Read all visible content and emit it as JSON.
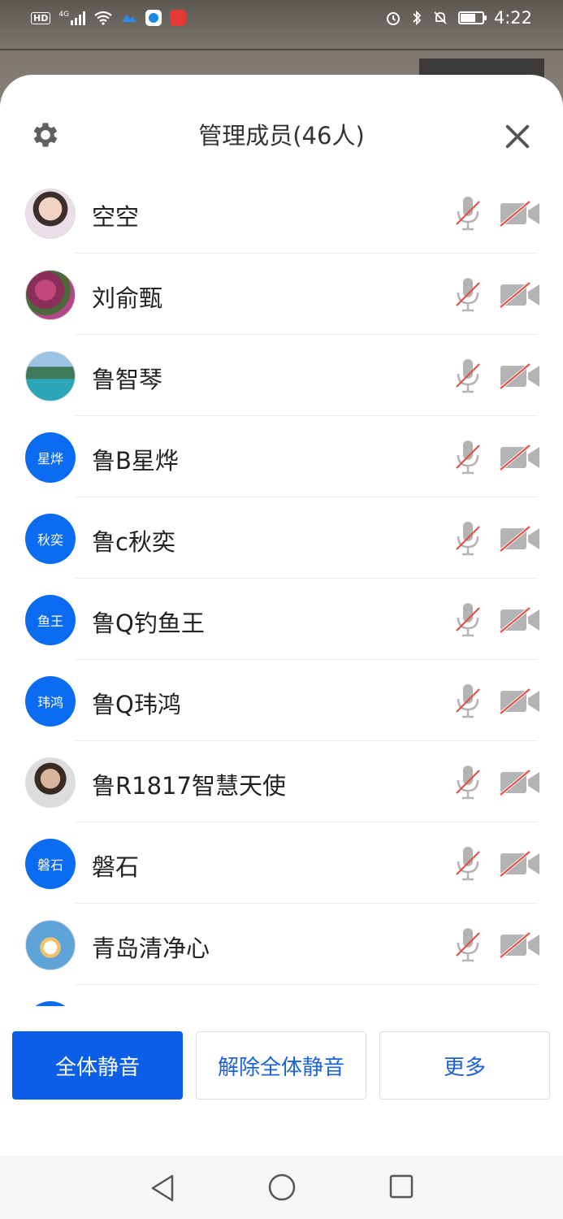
{
  "status_bar": {
    "network_badge": "HD",
    "network_type": "4G",
    "time": "4:22"
  },
  "header": {
    "title": "管理成员(46人)",
    "settings_icon": "gear-icon",
    "close_icon": "close-icon"
  },
  "members": [
    {
      "name": "空空",
      "avatar_type": "photo",
      "avatar_text": "",
      "mic": "muted",
      "camera": "off"
    },
    {
      "name": "刘俞甄",
      "avatar_type": "photo",
      "avatar_text": "",
      "mic": "muted",
      "camera": "off"
    },
    {
      "name": "鲁智琴",
      "avatar_type": "photo",
      "avatar_text": "",
      "mic": "muted",
      "camera": "off"
    },
    {
      "name": "鲁B星烨",
      "avatar_type": "text",
      "avatar_text": "星烨",
      "mic": "muted",
      "camera": "off"
    },
    {
      "name": "鲁c秋奕",
      "avatar_type": "text",
      "avatar_text": "秋奕",
      "mic": "muted",
      "camera": "off"
    },
    {
      "name": "鲁Q钓鱼王",
      "avatar_type": "text",
      "avatar_text": "鱼王",
      "mic": "muted",
      "camera": "off"
    },
    {
      "name": "鲁Q玮鸿",
      "avatar_type": "text",
      "avatar_text": "玮鸿",
      "mic": "muted",
      "camera": "off"
    },
    {
      "name": "鲁R1817智慧天使",
      "avatar_type": "photo",
      "avatar_text": "",
      "mic": "muted",
      "camera": "off"
    },
    {
      "name": "磐石",
      "avatar_type": "text",
      "avatar_text": "磐石",
      "mic": "muted",
      "camera": "off"
    },
    {
      "name": "青岛清净心",
      "avatar_type": "photo",
      "avatar_text": "",
      "mic": "muted",
      "camera": "off"
    }
  ],
  "buttons": {
    "mute_all": "全体静音",
    "unmute_all": "解除全体静音",
    "more": "更多"
  },
  "colors": {
    "primary": "#0b5ee8",
    "avatar_blue": "#0b6cf2",
    "muted_slash": "#e0524a",
    "icon_gray": "#b3b3b3"
  }
}
